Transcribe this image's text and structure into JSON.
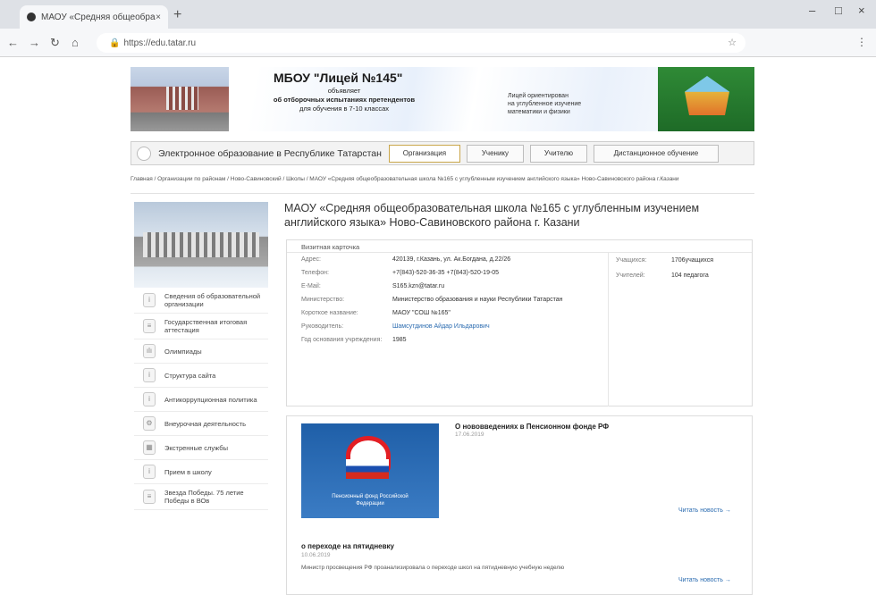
{
  "browser": {
    "tab_title": "МАОУ «Средняя общеобразо",
    "tab_close": "×",
    "new_tab": "+",
    "url": "https://edu.tatar.ru",
    "win_min": "–",
    "win_max": "□",
    "win_close": "×",
    "menu": "⋮"
  },
  "banner": {
    "title": "МБОУ \"Лицей №145\"",
    "sub1": "объявляет",
    "sub2": "об отборочных испытаниях претендентов",
    "sub3": "для обучения в 7-10 классах",
    "right1": "Лицей ориентирован",
    "right2": "на углубленное изучение",
    "right3": "математики и физики"
  },
  "navbar": {
    "title": "Электронное образование в Республике Татарстан",
    "buttons": [
      "Организация",
      "Ученику",
      "Учителю",
      "Дистанционное обучение"
    ]
  },
  "breadcrumb": "Главная / Организации по районам / Ново-Савиновский / Школы / МАОУ «Средняя общеобразовательная школа №165 с углубленным изучением английского языка» Ново-Савиновского района г.Казани",
  "sidebar": {
    "items": [
      {
        "label": "Сведения об образовательной организации",
        "icon": "i"
      },
      {
        "label": "Государственная итоговая аттестация",
        "icon": "≡"
      },
      {
        "label": "Олимпиады",
        "icon": "ılı"
      },
      {
        "label": "Структура сайта",
        "icon": "i"
      },
      {
        "label": "Антикоррупционная политика",
        "icon": "i"
      },
      {
        "label": "Внеурочная деятельность",
        "icon": "⚙"
      },
      {
        "label": "Экстренные службы",
        "icon": "▦"
      },
      {
        "label": "Прием в школу",
        "icon": "i"
      },
      {
        "label": "Звезда Победы. 75 летие Победы в ВОв",
        "icon": "≡"
      }
    ]
  },
  "main": {
    "title": "МАОУ «Средняя общеобразовательная школа №165 с углубленным изучением английского языка» Ново-Савиновского района г. Казани"
  },
  "card": {
    "head": "Визитная карточка",
    "rows": [
      {
        "k": "Адрес:",
        "v": "420139, г.Казань, ул. Ак.Богдана, д.22/26"
      },
      {
        "k": "Телефон:",
        "v": "+7(843)-520-36-35 +7(843)-520-19-05"
      },
      {
        "k": "E-Mail:",
        "v": "S165.kzn@tatar.ru"
      },
      {
        "k": "Министерство:",
        "v": "Министерство образования и науки Республики Татарстан"
      },
      {
        "k": "Короткое название:",
        "v": "МАОУ \"СОШ №165\""
      },
      {
        "k": "Руководитель:",
        "v": "Шамсутдинов Айдар Ильдарович"
      },
      {
        "k": "Год основания учреждения:",
        "v": "1985"
      }
    ],
    "right": [
      {
        "k": "Учащихся:",
        "v": "1706учащихся"
      },
      {
        "k": "Учителей:",
        "v": "104 педагога"
      }
    ]
  },
  "news": [
    {
      "title": "О нововведениях в Пенсионном фонде РФ",
      "date": "17.06.2019",
      "more": "Читать новость →"
    },
    {
      "title": "о переходе на пятидневку",
      "date": "10.06.2019",
      "text": "Министр просвещения РФ проанализировала о переходе школ на пятидневную учебную неделю",
      "more": "Читать новость →"
    }
  ],
  "news_img": {
    "caption": "Пенсионный фонд Российской Федерации"
  }
}
